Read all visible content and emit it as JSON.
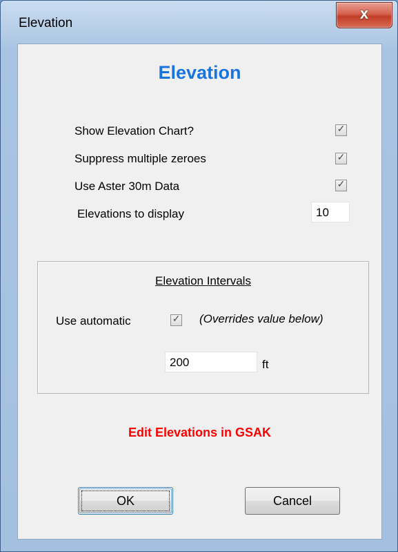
{
  "window": {
    "title": "Elevation"
  },
  "titlebar": {
    "close_glyph": "x"
  },
  "main": {
    "heading": "Elevation",
    "options": [
      {
        "label": "Show Elevation Chart?",
        "checked": true
      },
      {
        "label": "Suppress multiple zeroes",
        "checked": true
      },
      {
        "label": "Use Aster 30m Data",
        "checked": true
      }
    ],
    "elevations_label": "Elevations to display",
    "elevations_value": "10"
  },
  "intervals": {
    "title": "Elevation Intervals",
    "use_automatic_label": "Use automatic",
    "use_automatic_checked": true,
    "hint": "(Overrides value below)",
    "interval_value": "200",
    "unit": "ft"
  },
  "link": {
    "edit_gsak": "Edit Elevations in GSAK"
  },
  "buttons": {
    "ok": "OK",
    "cancel": "Cancel"
  },
  "icons": {
    "check": "check-mark",
    "close": "close-x"
  },
  "colors": {
    "heading": "#1874e0",
    "link": "#ff0000",
    "close_button": "#c23d26"
  }
}
